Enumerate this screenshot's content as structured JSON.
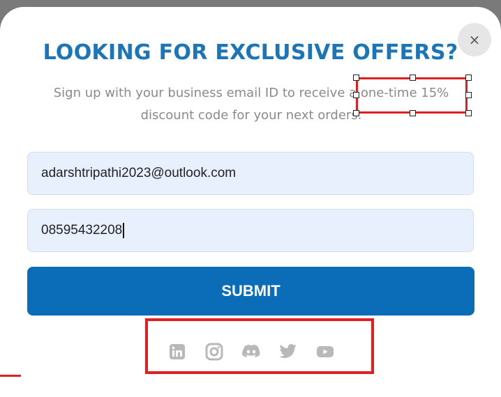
{
  "popup": {
    "close_label": "×",
    "title": "LOOKING FOR EXCLUSIVE OFFERS?",
    "subtitle": "Sign up with your business email ID to receive a one-time 15% discount code for your next orders.",
    "email_value": "adarshtripathi2023@outlook.com",
    "phone_value": "08595432208",
    "submit_label": "SUBMIT"
  },
  "social_icons": [
    "linkedin-icon",
    "instagram-icon",
    "discord-icon",
    "twitter-icon",
    "youtube-icon"
  ],
  "colors": {
    "title": "#1b75b9",
    "submit": "#0b6db8",
    "field_bg": "#e8f0fe",
    "annotation_red": "#e02020",
    "icon_grey": "#b8b8b8"
  }
}
